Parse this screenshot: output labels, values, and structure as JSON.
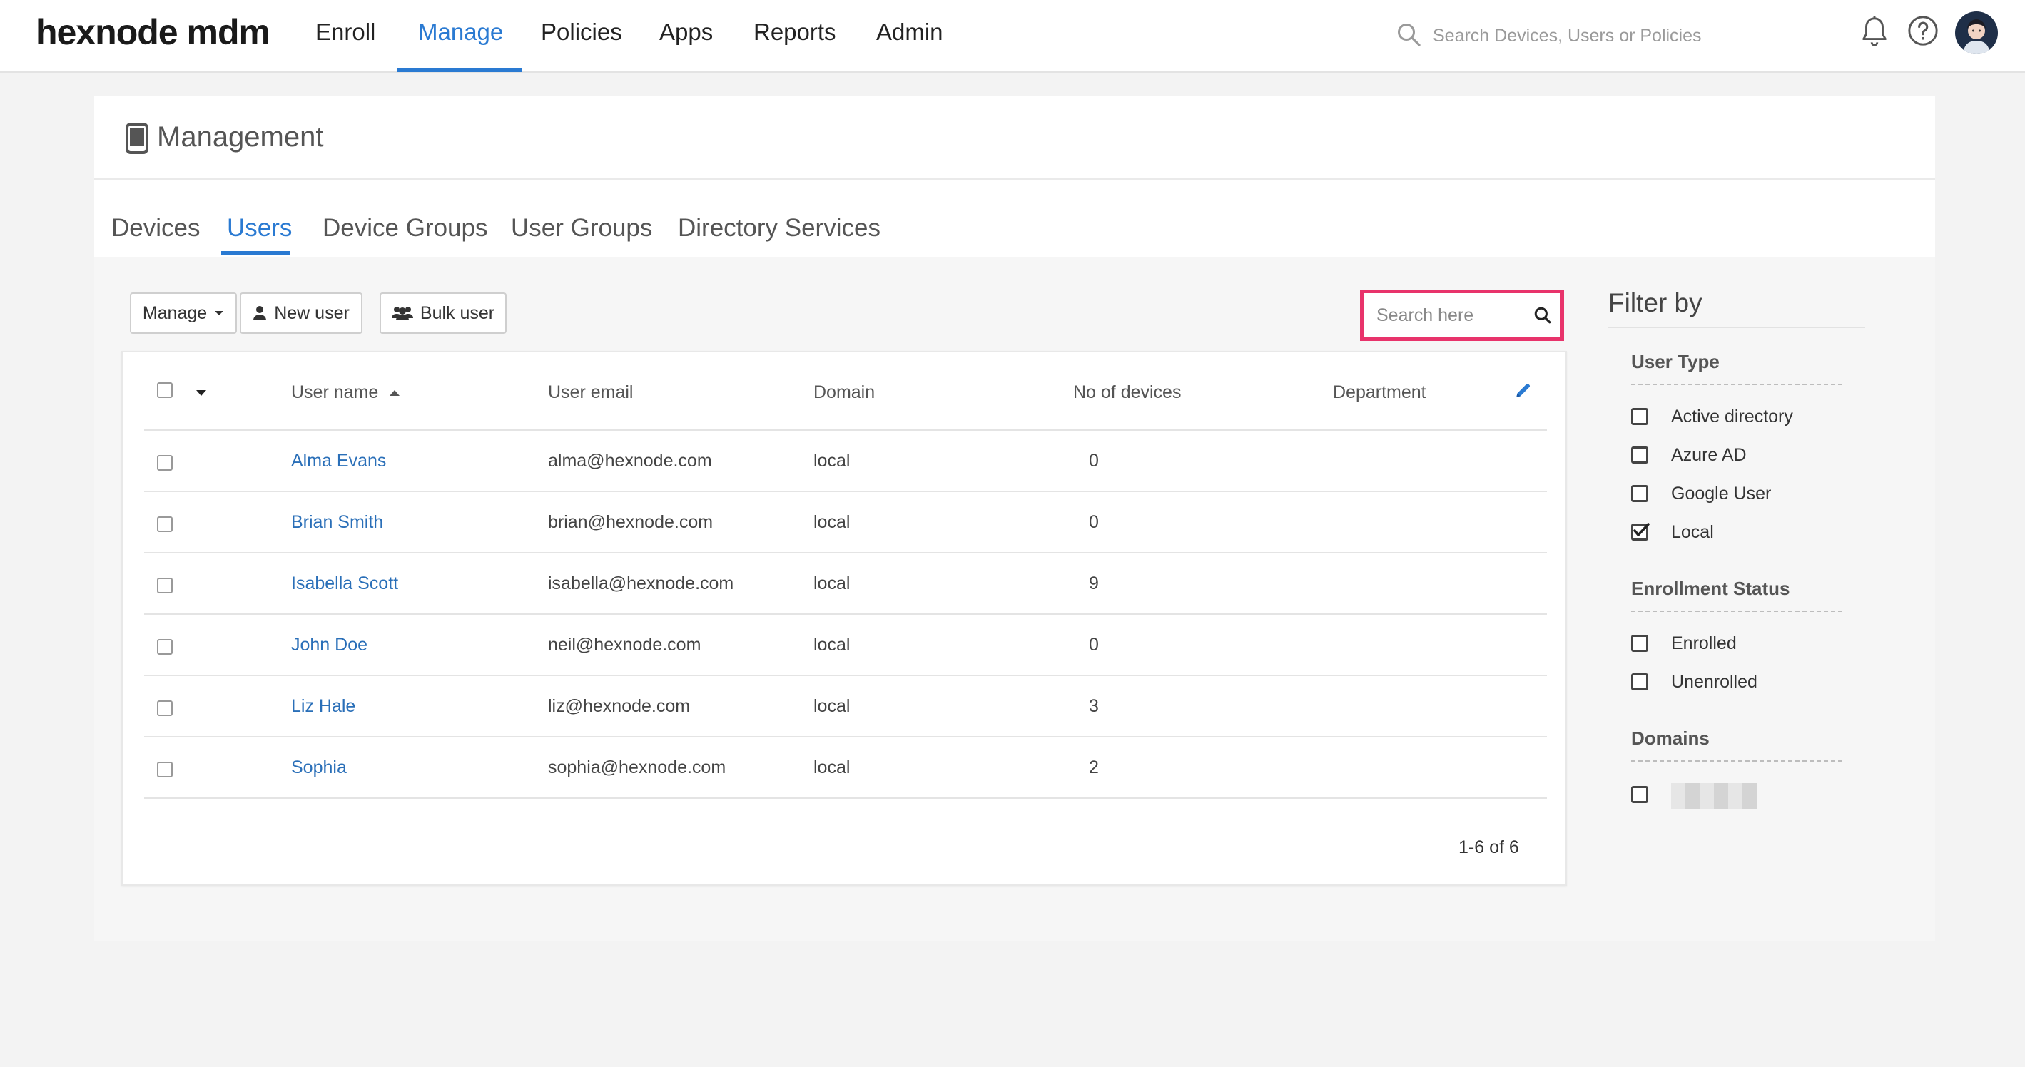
{
  "topnav": {
    "logo": "hexnode mdm",
    "items": [
      {
        "label": "Enroll"
      },
      {
        "label": "Manage"
      },
      {
        "label": "Policies"
      },
      {
        "label": "Apps"
      },
      {
        "label": "Reports"
      },
      {
        "label": "Admin"
      }
    ],
    "active": "Manage",
    "search_placeholder": "Search Devices, Users or Policies"
  },
  "page": {
    "title": "Management",
    "tabs": [
      {
        "label": "Devices"
      },
      {
        "label": "Users"
      },
      {
        "label": "Device Groups"
      },
      {
        "label": "User Groups"
      },
      {
        "label": "Directory Services"
      }
    ],
    "active_tab": "Users"
  },
  "toolbar": {
    "manage_label": "Manage",
    "new_user_label": "New user",
    "bulk_user_label": "Bulk user",
    "search_placeholder": "Search here"
  },
  "table": {
    "columns": [
      "User name",
      "User email",
      "Domain",
      "No of devices",
      "Department"
    ],
    "sort_column": "User name",
    "rows": [
      {
        "name": "Alma Evans",
        "email": "alma@hexnode.com",
        "domain": "local",
        "devices": "0",
        "department": ""
      },
      {
        "name": "Brian Smith",
        "email": "brian@hexnode.com",
        "domain": "local",
        "devices": "0",
        "department": ""
      },
      {
        "name": "Isabella Scott",
        "email": "isabella@hexnode.com",
        "domain": "local",
        "devices": "9",
        "department": ""
      },
      {
        "name": "John Doe",
        "email": "neil@hexnode.com",
        "domain": "local",
        "devices": "0",
        "department": ""
      },
      {
        "name": "Liz Hale",
        "email": "liz@hexnode.com",
        "domain": "local",
        "devices": "3",
        "department": ""
      },
      {
        "name": "Sophia",
        "email": "sophia@hexnode.com",
        "domain": "local",
        "devices": "2",
        "department": ""
      }
    ],
    "pagination": "1-6 of 6"
  },
  "filter": {
    "title": "Filter by",
    "sections": [
      {
        "title": "User Type",
        "options": [
          {
            "label": "Active directory",
            "checked": false
          },
          {
            "label": "Azure AD",
            "checked": false
          },
          {
            "label": "Google User",
            "checked": false
          },
          {
            "label": "Local",
            "checked": true
          }
        ]
      },
      {
        "title": "Enrollment Status",
        "options": [
          {
            "label": "Enrolled",
            "checked": false
          },
          {
            "label": "Unenrolled",
            "checked": false
          }
        ]
      },
      {
        "title": "Domains",
        "options": [
          {
            "label": "",
            "checked": false
          }
        ]
      }
    ]
  },
  "colors": {
    "accent": "#2a7ad2",
    "link": "#2a6fb8",
    "highlight": "#e8336b"
  }
}
